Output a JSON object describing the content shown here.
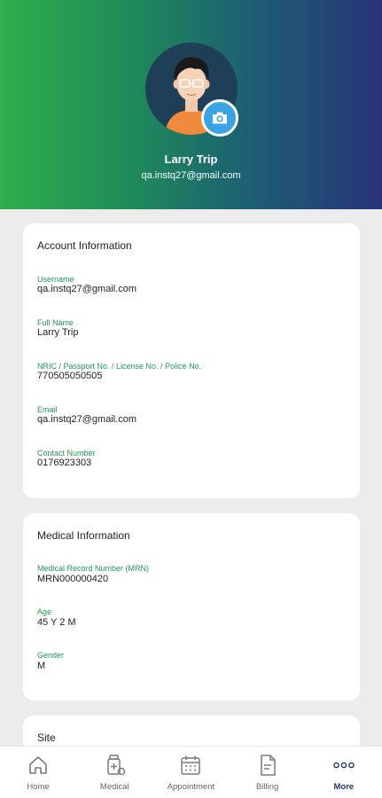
{
  "profile": {
    "name": "Larry Trip",
    "email": "qa.instq27@gmail.com"
  },
  "account": {
    "title": "Account Information",
    "fields": [
      {
        "label": "Username",
        "value": "qa.instq27@gmail.com"
      },
      {
        "label": "Full Name",
        "value": "Larry Trip"
      },
      {
        "label": "NRIC / Passport No. / License No. / Police No.",
        "value": "770505050505"
      },
      {
        "label": "Email",
        "value": "qa.instq27@gmail.com"
      },
      {
        "label": "Contact Number",
        "value": "0176923303"
      }
    ]
  },
  "medical": {
    "title": "Medical Information",
    "fields": [
      {
        "label": "Medical Record Number (MRN)",
        "value": "MRN000000420"
      },
      {
        "label": "Age",
        "value": "45 Y 2 M"
      },
      {
        "label": "Gender",
        "value": "M"
      }
    ]
  },
  "site": {
    "title": "Site"
  },
  "nav": {
    "items": [
      {
        "label": "Home",
        "icon": "home-icon"
      },
      {
        "label": "Medical",
        "icon": "medicine-icon"
      },
      {
        "label": "Appointment",
        "icon": "calendar-icon"
      },
      {
        "label": "Billing",
        "icon": "bill-icon"
      },
      {
        "label": "More",
        "icon": "more-icon"
      }
    ],
    "active": "More"
  },
  "colors": {
    "header_start": "#2fae4b",
    "header_end": "#283378",
    "label_green": "#1f9a55",
    "camera_blue": "#3aa3e3",
    "nav_active": "#283378"
  }
}
